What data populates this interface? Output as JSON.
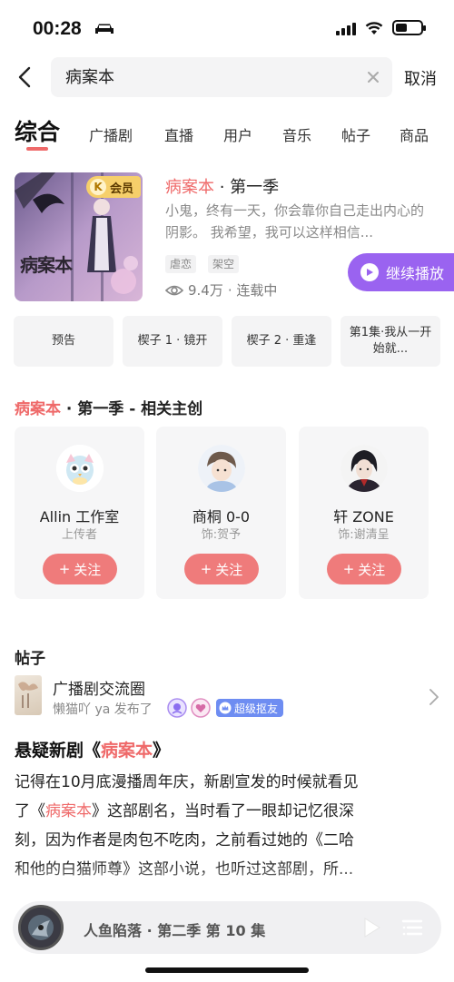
{
  "status_bar": {
    "time": "00:28",
    "battery_level": 0.45,
    "icons": [
      "car-icon",
      "signal-icon",
      "wifi-icon",
      "battery-icon"
    ]
  },
  "search": {
    "value": "病案本",
    "cancel_label": "取消"
  },
  "tabs": [
    {
      "label": "综合",
      "active": true
    },
    {
      "label": "广播剧"
    },
    {
      "label": "直播"
    },
    {
      "label": "用户"
    },
    {
      "label": "音乐"
    },
    {
      "label": "帖子"
    },
    {
      "label": "商品"
    }
  ],
  "drama": {
    "vip_badge": "会员",
    "vip_k": "K",
    "cover_title": "病案本",
    "title_highlight": "病案本",
    "title_rest": " · 第一季",
    "description": "小鬼，终有一天，你会靠你自己走出内心的阴影。 我希望，我可以这样相信...",
    "tags": [
      "虐恋",
      "架空"
    ],
    "plays": "9.4万",
    "status": "· 连载中",
    "continue_label": "继续播放"
  },
  "episodes": [
    "预告",
    "楔子 1 · 镜开",
    "楔子 2 · 重逢",
    "第1集·我从一开始就..."
  ],
  "creators_section": {
    "title_highlight": "病案本",
    "title_rest": " · 第一季 - 相关主创"
  },
  "creators": [
    {
      "name": "Allin 工作室",
      "role": "上传者",
      "follow": "关注"
    },
    {
      "name": "商桐 0-0",
      "role": "饰:贺予",
      "follow": "关注"
    },
    {
      "name": "轩 ZONE",
      "role": "饰:谢清呈",
      "follow": "关注"
    }
  ],
  "posts": {
    "heading": "帖子",
    "circle_name": "广播剧交流圈",
    "author_meta": "懒猫吖 ya 发布了",
    "super_badge": "超级抠友",
    "title_prefix": "悬疑新剧《",
    "title_highlight": "病案本",
    "title_suffix": "》",
    "body_line1": "记得在10月底漫播周年庆，新剧宣发的时候就看见",
    "body_line2_a": "了《",
    "body_line2_hl": "病案本",
    "body_line2_b": "》这部剧名，当时看了一眼却记忆很深",
    "body_line3": "刻，因为作者是肉包不吃肉，之前看过她的《二哈",
    "body_line4": "和他的白猫师尊》这部小说，也听过这部剧，所..."
  },
  "mini_player": {
    "now_playing": "人鱼陷落 · 第二季 第 10 集"
  },
  "colors": {
    "accent": "#ef6a6a",
    "play_purple": "#9a63f0",
    "vip_gold": "#f6cf6a"
  }
}
